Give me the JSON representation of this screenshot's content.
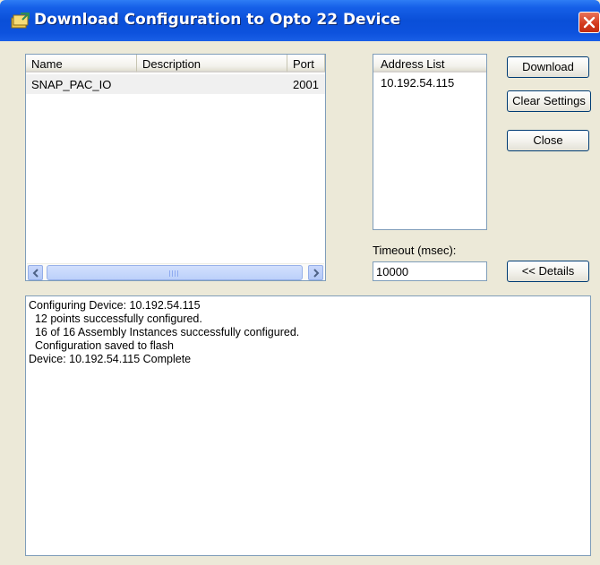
{
  "window": {
    "title": "Download Configuration to Opto 22 Device",
    "title_icon": "opto-config-icon",
    "close_icon": "close-x-icon"
  },
  "device_list": {
    "columns": [
      "Name",
      "Description",
      "Port"
    ],
    "rows": [
      {
        "name": "SNAP_PAC_IO",
        "description": "",
        "port": "2001"
      }
    ],
    "scrollbar_grip": "III"
  },
  "address_list": {
    "header": "Address List",
    "items": [
      "10.192.54.115"
    ]
  },
  "timeout": {
    "label": "Timeout (msec):",
    "value": "10000"
  },
  "buttons": {
    "download": "Download",
    "clear_settings": "Clear Settings",
    "close": "Close",
    "details": "<< Details"
  },
  "log": {
    "lines": [
      "Configuring Device: 10.192.54.115",
      "  12 points successfully configured.",
      "  16 of 16 Assembly Instances successfully configured.",
      "  Configuration saved to flash",
      "Device: 10.192.54.115 Complete"
    ]
  },
  "colors": {
    "titlebar": "#0a4fd8",
    "dialog_bg": "#ece9d8",
    "field_border": "#7f9db9",
    "button_border": "#003c74",
    "close_button": "#d2391c"
  }
}
